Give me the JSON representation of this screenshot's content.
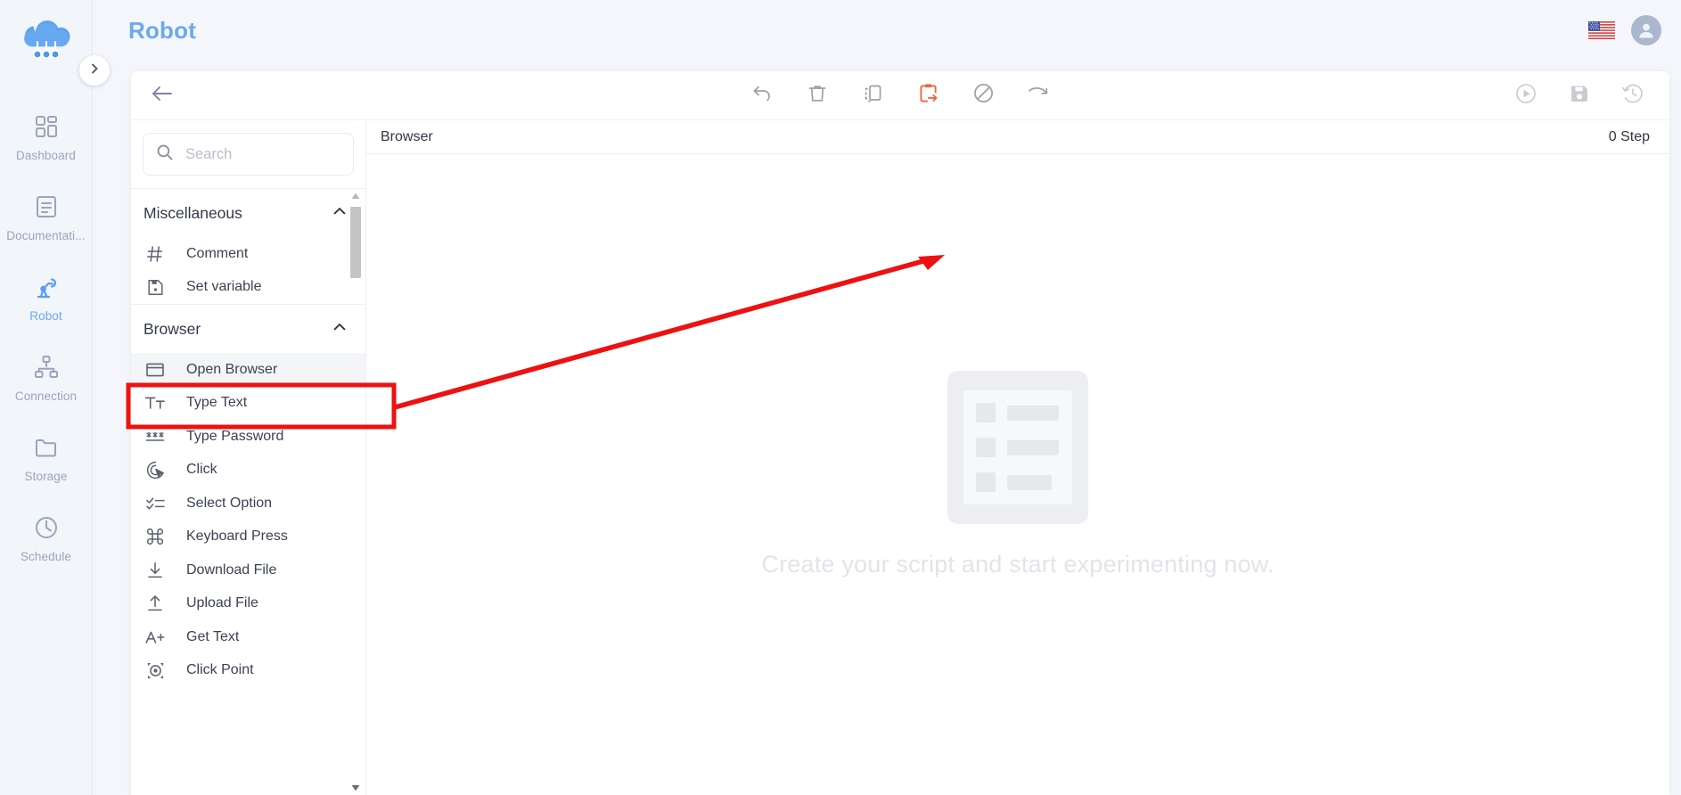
{
  "brand": {
    "logo_icon": "cloud-network-logo"
  },
  "header": {
    "title": "Robot",
    "language_flag_icon": "us-flag-icon",
    "avatar_icon": "user-avatar-icon"
  },
  "sidebar": {
    "expand_icon": "chevron-right-icon",
    "items": [
      {
        "label": "Dashboard",
        "icon": "grid-dashboard-icon",
        "active": false
      },
      {
        "label": "Documentati...",
        "icon": "document-icon",
        "active": false
      },
      {
        "label": "Robot",
        "icon": "robot-arm-icon",
        "active": true
      },
      {
        "label": "Connection",
        "icon": "sitemap-connection-icon",
        "active": false
      },
      {
        "label": "Storage",
        "icon": "folder-icon",
        "active": false
      },
      {
        "label": "Schedule",
        "icon": "clock-icon",
        "active": false
      }
    ]
  },
  "toolbar": {
    "back_icon": "arrow-left-icon",
    "center_tools": [
      {
        "name": "undo-button",
        "icon": "undo-icon",
        "active": false
      },
      {
        "name": "delete-button",
        "icon": "trash-icon",
        "active": false
      },
      {
        "name": "copy-button",
        "icon": "copy-icon",
        "active": false
      },
      {
        "name": "paste-button",
        "icon": "clipboard-paste-icon",
        "active": true
      },
      {
        "name": "disable-button",
        "icon": "no-entry-icon",
        "active": false
      },
      {
        "name": "redo-button",
        "icon": "redo-icon",
        "active": false
      }
    ],
    "right_tools": [
      {
        "name": "run-button",
        "icon": "play-circle-icon"
      },
      {
        "name": "save-button",
        "icon": "floppy-save-icon"
      },
      {
        "name": "history-button",
        "icon": "clock-history-icon"
      }
    ],
    "accent_color": "#f2643c"
  },
  "palette": {
    "search": {
      "placeholder": "Search",
      "value": "",
      "icon": "search-icon"
    },
    "groups": [
      {
        "title": "Miscellaneous",
        "collapse_icon": "chevron-up-icon",
        "items": [
          {
            "label": "Comment",
            "icon": "hash-icon"
          },
          {
            "label": "Set variable",
            "icon": "save-disk-icon"
          }
        ]
      },
      {
        "title": "Browser",
        "collapse_icon": "chevron-up-icon",
        "items": [
          {
            "label": "Open Browser",
            "icon": "browser-window-icon",
            "selected": true
          },
          {
            "label": "Type Text",
            "icon": "text-format-icon",
            "selected": false
          },
          {
            "label": "Type Password",
            "icon": "asterisks-password-icon",
            "selected": false
          },
          {
            "label": "Click",
            "icon": "cursor-click-icon",
            "selected": false
          },
          {
            "label": "Select Option",
            "icon": "checklist-icon",
            "selected": false
          },
          {
            "label": "Keyboard Press",
            "icon": "command-key-icon",
            "selected": false
          },
          {
            "label": "Download File",
            "icon": "download-icon",
            "selected": false
          },
          {
            "label": "Upload File",
            "icon": "upload-icon",
            "selected": false
          },
          {
            "label": "Get Text",
            "icon": "a-plus-icon",
            "selected": false
          },
          {
            "label": "Click Point",
            "icon": "crosshair-target-icon",
            "selected": false
          }
        ]
      }
    ],
    "scrollbar": {
      "up_icon": "caret-up-icon",
      "down_icon": "caret-down-icon"
    }
  },
  "canvas": {
    "title": "Browser",
    "step_count": "0 Step",
    "empty_message": "Create your script and start experimenting now.",
    "empty_icon": "empty-script-placeholder-icon"
  },
  "annotation": {
    "highlight_color": "#ee1111",
    "highlight_target": "Open Browser",
    "arrow_icon": "red-pointer-arrow"
  }
}
